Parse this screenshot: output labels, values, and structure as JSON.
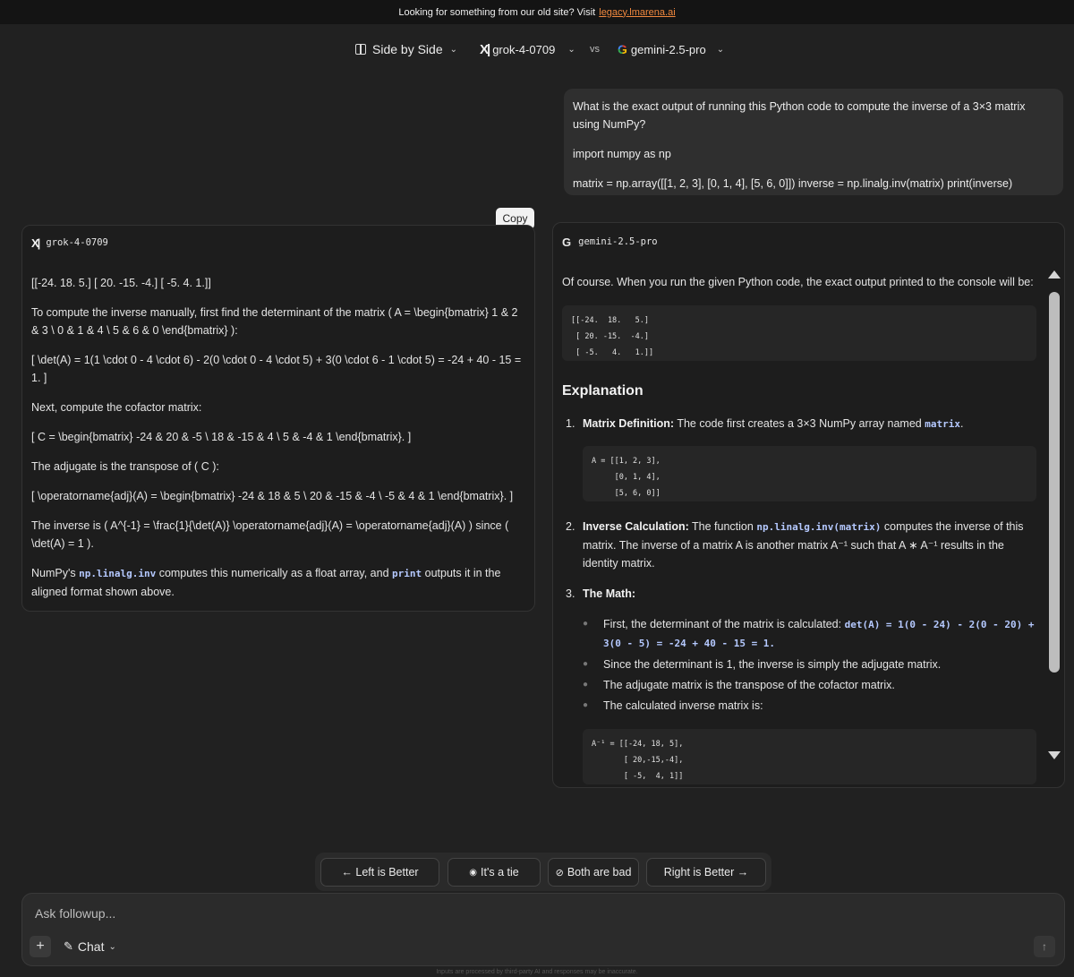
{
  "banner": {
    "text": "Looking for something from our old site? Visit",
    "link": "legacy.lmarena.ai"
  },
  "header": {
    "mode_label": "Side by Side",
    "model_a": "grok-4-0709",
    "vs": "vs",
    "model_b": "gemini-2.5-pro"
  },
  "prompt": {
    "line1": "What is the exact output of running this Python code to compute the inverse of a 3×3 matrix using NumPy?",
    "line2": "import numpy as np",
    "line3": "matrix = np.array([[1, 2, 3], [0, 1, 4], [5, 6, 0]]) inverse = np.linalg.inv(matrix) print(inverse)"
  },
  "copy_label": "Copy",
  "left_panel": {
    "model": "grok-4-0709",
    "p1": "[[-24. 18. 5.] [ 20. -15. -4.] [ -5. 4. 1.]]",
    "p2": "To compute the inverse manually, first find the determinant of the matrix ( A = \\begin{bmatrix} 1 & 2 & 3 \\ 0 & 1 & 4 \\ 5 & 6 & 0 \\end{bmatrix} ):",
    "p3": "[ \\det(A) = 1(1 \\cdot 0 - 4 \\cdot 6) - 2(0 \\cdot 0 - 4 \\cdot 5) + 3(0 \\cdot 6 - 1 \\cdot 5) = -24 + 40 - 15 = 1. ]",
    "p4": "Next, compute the cofactor matrix:",
    "p5": "[ C = \\begin{bmatrix} -24 & 20 & -5 \\ 18 & -15 & 4 \\ 5 & -4 & 1 \\end{bmatrix}. ]",
    "p6": "The adjugate is the transpose of ( C ):",
    "p7": "[ \\operatorname{adj}(A) = \\begin{bmatrix} -24 & 18 & 5 \\ 20 & -15 & -4 \\ -5 & 4 & 1 \\end{bmatrix}. ]",
    "p8": "The inverse is ( A^{-1} = \\frac{1}{\\det(A)} \\operatorname{adj}(A) = \\operatorname{adj}(A) ) since ( \\det(A) = 1 ).",
    "p9_pre": "NumPy's",
    "p9_code1": "np.linalg.inv",
    "p9_mid": "computes this numerically as a float array, and",
    "p9_code2": "print",
    "p9_post": "outputs it in the aligned format shown above."
  },
  "right_panel": {
    "model": "gemini-2.5-pro",
    "intro": "Of course. When you run the given Python code, the exact output printed to the console will be:",
    "output_block": "[[-24.  18.   5.]\n [ 20. -15.  -4.]\n [ -5.   4.   1.]]",
    "heading": "Explanation",
    "item1_num": "1.",
    "item1_title": "Matrix Definition:",
    "item1_text": "The code first creates a 3×3 NumPy array named",
    "item1_code": "matrix",
    "item1_end": ".",
    "matrix_block": "A = [[1, 2, 3],\n     [0, 1, 4],\n     [5, 6, 0]]",
    "item2_num": "2.",
    "item2_title": "Inverse Calculation:",
    "item2_pre": "The function",
    "item2_code": "np.linalg.inv(matrix)",
    "item2_text": "computes the inverse of this matrix. The inverse of a matrix A is another matrix A⁻¹ such that A ∗ A⁻¹ results in the identity matrix.",
    "item3_num": "3.",
    "item3_title": "The Math:",
    "bullet1_text": "First, the determinant of the matrix is calculated:",
    "bullet1_code": "det(A) = 1(0 - 24) - 2(0 - 20) + 3(0 - 5) = -24 + 40 - 15 = 1.",
    "bullet2": "Since the determinant is 1, the inverse is simply the adjugate matrix.",
    "bullet3": "The adjugate matrix is the transpose of the cofactor matrix.",
    "bullet4": "The calculated inverse matrix is:",
    "inverse_block": "A⁻¹ = [[-24, 18, 5],\n       [ 20,-15,-4],\n       [ -5,  4, 1]]"
  },
  "vote": {
    "left": "← Left is Better",
    "tie": "It's a tie",
    "bad": "Both are bad",
    "right": "Right is Better →"
  },
  "input": {
    "placeholder": "Ask followup...",
    "mode": "Chat"
  },
  "disclaimer": "Inputs are processed by third-party AI and responses may be inaccurate.",
  "colors": {
    "background": "#212121",
    "link": "#f0883e",
    "code_inline": "#b5c9ff"
  }
}
